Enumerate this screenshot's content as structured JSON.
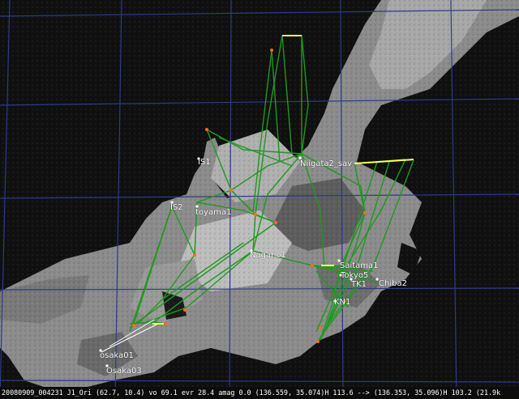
{
  "colors": {
    "background": "#101010",
    "land_light": "#bdbdbd",
    "land_mid": "#8c8c8c",
    "land_dark": "#5a5a5a",
    "grid": "#2c3b86",
    "meteor_path": "#1e9a1e",
    "meteor_start": "#ffff55",
    "meteor_end": "#ff6a1a",
    "label": "#ffffff"
  },
  "stations": [
    {
      "id": "IS1",
      "name": "IS1"
    },
    {
      "id": "IS2",
      "name": "IS2"
    },
    {
      "id": "toyama1",
      "name": "toyama1"
    },
    {
      "id": "Niigata2",
      "name": "Niigata2_sav"
    },
    {
      "id": "Nagano1",
      "name": "Nagano1"
    },
    {
      "id": "Saitama1",
      "name": "Saitama1"
    },
    {
      "id": "Tokyo5",
      "name": "Tokyo5"
    },
    {
      "id": "TK1",
      "name": "TK1"
    },
    {
      "id": "Chiba2",
      "name": "Chiba2"
    },
    {
      "id": "KN1",
      "name": "KN1"
    },
    {
      "id": "osaka01",
      "name": "osaka01"
    },
    {
      "id": "Osaka03",
      "name": "Osaka03"
    }
  ],
  "status_line": "20080909_004231  J1_Ori  (62.7, 10.4)  vo 69.1  evr 28.4  amag  0.0   (136.559, 35.074)H 113.6  -->  (136.353, 35.096)H 103.2  (21.9k"
}
